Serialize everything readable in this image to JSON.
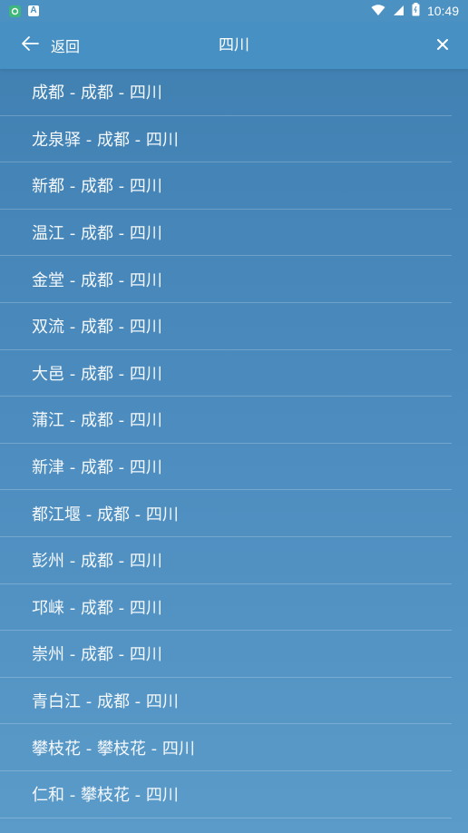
{
  "status_bar": {
    "time": "10:49",
    "a_icon_label": "A",
    "icons": [
      "app-notification-icon",
      "a-notification-icon",
      "wifi-icon",
      "signal-icon",
      "battery-icon"
    ]
  },
  "header": {
    "back_label": "返回",
    "title": "四川"
  },
  "cities": [
    "成都 - 成都 - 四川",
    "龙泉驿 - 成都 - 四川",
    "新都 - 成都 - 四川",
    "温江 - 成都 - 四川",
    "金堂 - 成都 - 四川",
    "双流 - 成都 - 四川",
    "大邑 - 成都 - 四川",
    "蒲江 - 成都 - 四川",
    "新津 - 成都 - 四川",
    "都江堰 - 成都 - 四川",
    "彭州 - 成都 - 四川",
    "邛崃 - 成都 - 四川",
    "崇州 - 成都 - 四川",
    "青白江 - 成都 - 四川",
    "攀枝花 - 攀枝花 - 四川",
    "仁和 - 攀枝花 - 四川"
  ]
}
